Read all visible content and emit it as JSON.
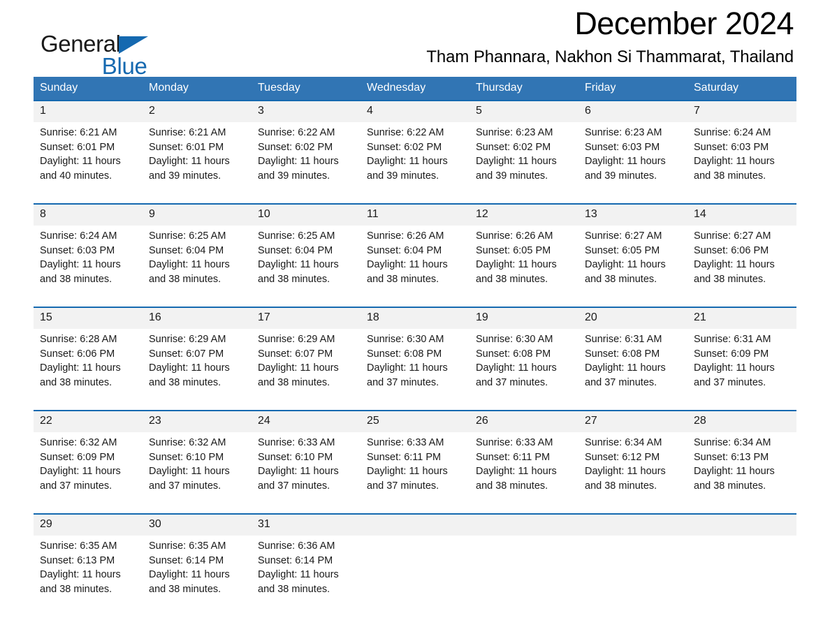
{
  "brand": {
    "name_part1": "General",
    "name_part2": "Blue",
    "accent_color": "#1569b0"
  },
  "header": {
    "month_title": "December 2024",
    "location": "Tham Phannara, Nakhon Si Thammarat, Thailand"
  },
  "calendar": {
    "header_bg": "#3175b4",
    "weekdays": [
      "Sunday",
      "Monday",
      "Tuesday",
      "Wednesday",
      "Thursday",
      "Friday",
      "Saturday"
    ],
    "weeks": [
      [
        {
          "day": "1",
          "sunrise": "Sunrise: 6:21 AM",
          "sunset": "Sunset: 6:01 PM",
          "daylight_line1": "Daylight: 11 hours",
          "daylight_line2": "and 40 minutes."
        },
        {
          "day": "2",
          "sunrise": "Sunrise: 6:21 AM",
          "sunset": "Sunset: 6:01 PM",
          "daylight_line1": "Daylight: 11 hours",
          "daylight_line2": "and 39 minutes."
        },
        {
          "day": "3",
          "sunrise": "Sunrise: 6:22 AM",
          "sunset": "Sunset: 6:02 PM",
          "daylight_line1": "Daylight: 11 hours",
          "daylight_line2": "and 39 minutes."
        },
        {
          "day": "4",
          "sunrise": "Sunrise: 6:22 AM",
          "sunset": "Sunset: 6:02 PM",
          "daylight_line1": "Daylight: 11 hours",
          "daylight_line2": "and 39 minutes."
        },
        {
          "day": "5",
          "sunrise": "Sunrise: 6:23 AM",
          "sunset": "Sunset: 6:02 PM",
          "daylight_line1": "Daylight: 11 hours",
          "daylight_line2": "and 39 minutes."
        },
        {
          "day": "6",
          "sunrise": "Sunrise: 6:23 AM",
          "sunset": "Sunset: 6:03 PM",
          "daylight_line1": "Daylight: 11 hours",
          "daylight_line2": "and 39 minutes."
        },
        {
          "day": "7",
          "sunrise": "Sunrise: 6:24 AM",
          "sunset": "Sunset: 6:03 PM",
          "daylight_line1": "Daylight: 11 hours",
          "daylight_line2": "and 38 minutes."
        }
      ],
      [
        {
          "day": "8",
          "sunrise": "Sunrise: 6:24 AM",
          "sunset": "Sunset: 6:03 PM",
          "daylight_line1": "Daylight: 11 hours",
          "daylight_line2": "and 38 minutes."
        },
        {
          "day": "9",
          "sunrise": "Sunrise: 6:25 AM",
          "sunset": "Sunset: 6:04 PM",
          "daylight_line1": "Daylight: 11 hours",
          "daylight_line2": "and 38 minutes."
        },
        {
          "day": "10",
          "sunrise": "Sunrise: 6:25 AM",
          "sunset": "Sunset: 6:04 PM",
          "daylight_line1": "Daylight: 11 hours",
          "daylight_line2": "and 38 minutes."
        },
        {
          "day": "11",
          "sunrise": "Sunrise: 6:26 AM",
          "sunset": "Sunset: 6:04 PM",
          "daylight_line1": "Daylight: 11 hours",
          "daylight_line2": "and 38 minutes."
        },
        {
          "day": "12",
          "sunrise": "Sunrise: 6:26 AM",
          "sunset": "Sunset: 6:05 PM",
          "daylight_line1": "Daylight: 11 hours",
          "daylight_line2": "and 38 minutes."
        },
        {
          "day": "13",
          "sunrise": "Sunrise: 6:27 AM",
          "sunset": "Sunset: 6:05 PM",
          "daylight_line1": "Daylight: 11 hours",
          "daylight_line2": "and 38 minutes."
        },
        {
          "day": "14",
          "sunrise": "Sunrise: 6:27 AM",
          "sunset": "Sunset: 6:06 PM",
          "daylight_line1": "Daylight: 11 hours",
          "daylight_line2": "and 38 minutes."
        }
      ],
      [
        {
          "day": "15",
          "sunrise": "Sunrise: 6:28 AM",
          "sunset": "Sunset: 6:06 PM",
          "daylight_line1": "Daylight: 11 hours",
          "daylight_line2": "and 38 minutes."
        },
        {
          "day": "16",
          "sunrise": "Sunrise: 6:29 AM",
          "sunset": "Sunset: 6:07 PM",
          "daylight_line1": "Daylight: 11 hours",
          "daylight_line2": "and 38 minutes."
        },
        {
          "day": "17",
          "sunrise": "Sunrise: 6:29 AM",
          "sunset": "Sunset: 6:07 PM",
          "daylight_line1": "Daylight: 11 hours",
          "daylight_line2": "and 38 minutes."
        },
        {
          "day": "18",
          "sunrise": "Sunrise: 6:30 AM",
          "sunset": "Sunset: 6:08 PM",
          "daylight_line1": "Daylight: 11 hours",
          "daylight_line2": "and 37 minutes."
        },
        {
          "day": "19",
          "sunrise": "Sunrise: 6:30 AM",
          "sunset": "Sunset: 6:08 PM",
          "daylight_line1": "Daylight: 11 hours",
          "daylight_line2": "and 37 minutes."
        },
        {
          "day": "20",
          "sunrise": "Sunrise: 6:31 AM",
          "sunset": "Sunset: 6:08 PM",
          "daylight_line1": "Daylight: 11 hours",
          "daylight_line2": "and 37 minutes."
        },
        {
          "day": "21",
          "sunrise": "Sunrise: 6:31 AM",
          "sunset": "Sunset: 6:09 PM",
          "daylight_line1": "Daylight: 11 hours",
          "daylight_line2": "and 37 minutes."
        }
      ],
      [
        {
          "day": "22",
          "sunrise": "Sunrise: 6:32 AM",
          "sunset": "Sunset: 6:09 PM",
          "daylight_line1": "Daylight: 11 hours",
          "daylight_line2": "and 37 minutes."
        },
        {
          "day": "23",
          "sunrise": "Sunrise: 6:32 AM",
          "sunset": "Sunset: 6:10 PM",
          "daylight_line1": "Daylight: 11 hours",
          "daylight_line2": "and 37 minutes."
        },
        {
          "day": "24",
          "sunrise": "Sunrise: 6:33 AM",
          "sunset": "Sunset: 6:10 PM",
          "daylight_line1": "Daylight: 11 hours",
          "daylight_line2": "and 37 minutes."
        },
        {
          "day": "25",
          "sunrise": "Sunrise: 6:33 AM",
          "sunset": "Sunset: 6:11 PM",
          "daylight_line1": "Daylight: 11 hours",
          "daylight_line2": "and 37 minutes."
        },
        {
          "day": "26",
          "sunrise": "Sunrise: 6:33 AM",
          "sunset": "Sunset: 6:11 PM",
          "daylight_line1": "Daylight: 11 hours",
          "daylight_line2": "and 38 minutes."
        },
        {
          "day": "27",
          "sunrise": "Sunrise: 6:34 AM",
          "sunset": "Sunset: 6:12 PM",
          "daylight_line1": "Daylight: 11 hours",
          "daylight_line2": "and 38 minutes."
        },
        {
          "day": "28",
          "sunrise": "Sunrise: 6:34 AM",
          "sunset": "Sunset: 6:13 PM",
          "daylight_line1": "Daylight: 11 hours",
          "daylight_line2": "and 38 minutes."
        }
      ],
      [
        {
          "day": "29",
          "sunrise": "Sunrise: 6:35 AM",
          "sunset": "Sunset: 6:13 PM",
          "daylight_line1": "Daylight: 11 hours",
          "daylight_line2": "and 38 minutes."
        },
        {
          "day": "30",
          "sunrise": "Sunrise: 6:35 AM",
          "sunset": "Sunset: 6:14 PM",
          "daylight_line1": "Daylight: 11 hours",
          "daylight_line2": "and 38 minutes."
        },
        {
          "day": "31",
          "sunrise": "Sunrise: 6:36 AM",
          "sunset": "Sunset: 6:14 PM",
          "daylight_line1": "Daylight: 11 hours",
          "daylight_line2": "and 38 minutes."
        },
        {
          "day": "",
          "sunrise": "",
          "sunset": "",
          "daylight_line1": "",
          "daylight_line2": ""
        },
        {
          "day": "",
          "sunrise": "",
          "sunset": "",
          "daylight_line1": "",
          "daylight_line2": ""
        },
        {
          "day": "",
          "sunrise": "",
          "sunset": "",
          "daylight_line1": "",
          "daylight_line2": ""
        },
        {
          "day": "",
          "sunrise": "",
          "sunset": "",
          "daylight_line1": "",
          "daylight_line2": ""
        }
      ]
    ]
  }
}
